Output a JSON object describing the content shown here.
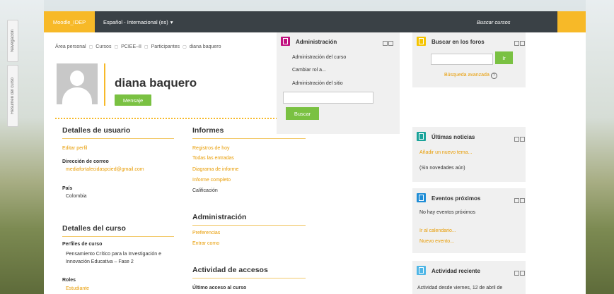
{
  "drawer": {
    "tab_navigation": "Navegación",
    "tab_course_summary": "Resumen del curso"
  },
  "topbar": {
    "brand": "Moodle_IDEP",
    "language": "Español - Internacional (es)",
    "search_courses": "Buscar cursos"
  },
  "breadcrumb": [
    "Área personal",
    "Cursos",
    "PCIEE–II",
    "Participantes",
    "diana baquero"
  ],
  "profile": {
    "name": "diana baquero",
    "message_button": "Mensaje"
  },
  "user_details": {
    "title": "Detalles de usuario",
    "edit_profile": "Editar perfil",
    "email_label": "Dirección de correo",
    "email_value": "mediafortalecidaspcied@gmail.com",
    "country_label": "País",
    "country_value": "Colombia"
  },
  "course_details": {
    "title": "Detalles del curso",
    "profiles_label": "Perfiles de curso",
    "profile_course": "Pensamiento Crítico para la Investigación e Innovación Educativa – Fase 2",
    "roles_label": "Roles",
    "role_value": "Estudiante"
  },
  "reports": {
    "title": "Informes",
    "links": [
      "Registros de hoy",
      "Todas las entradas",
      "Diagrama de informe",
      "Informe completo"
    ],
    "grade": "Calificación"
  },
  "administration": {
    "title": "Administración",
    "links": [
      "Preferencias",
      "Entrar como"
    ]
  },
  "access": {
    "title": "Actividad de accesos",
    "last_access": "Último acceso al curso"
  },
  "admin_block": {
    "title": "Administración",
    "items": [
      "Administración del curso",
      "Cambiar rol a...",
      "Administración del sitio"
    ],
    "search_button": "Buscar"
  },
  "forum_search": {
    "title": "Buscar en los foros",
    "go_button": "Ir",
    "advanced": "Búsqueda avanzada"
  },
  "news": {
    "title": "Últimas noticias",
    "add_topic": "Añadir un nuevo tema...",
    "none": "(Sin novedades aún)"
  },
  "events": {
    "title": "Eventos próximos",
    "none": "No hay eventos próximos",
    "calendar": "Ir al calendario...",
    "new_event": "Nuevo evento..."
  },
  "recent": {
    "title": "Actividad reciente",
    "since": "Actividad desde viernes, 12 de abril de"
  },
  "colors": {
    "accent": "#f7b928",
    "green": "#7ac142",
    "topbar": "#3a4146",
    "magenta": "#c0117f",
    "yellow": "#f5c400",
    "teal": "#1aa39a",
    "blue": "#1f8dd6",
    "light_blue": "#4fb6e6"
  }
}
